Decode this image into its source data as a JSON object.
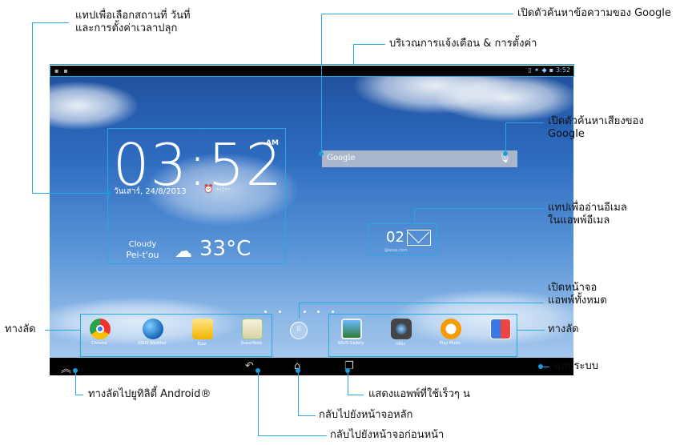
{
  "status_bar": {
    "time": "3:52"
  },
  "clock_widget": {
    "time": "03:52",
    "ampm": "AM",
    "date": "วันเสาร์, 24/8/2013",
    "alarm": "--:--"
  },
  "weather": {
    "condition": "Cloudy",
    "location": "Pei-t'ou",
    "temperature": "33°C",
    "icon": "cloudy-icon"
  },
  "search": {
    "placeholder": "Google"
  },
  "email_widget": {
    "count": "02",
    "account": "@asus.com"
  },
  "left_shortcuts": [
    {
      "label": "Chrome",
      "icon": "chrome-icon"
    },
    {
      "label": "ASUS Weather",
      "icon": "globe-icon"
    },
    {
      "label": "อีเมล",
      "icon": "email-app-icon"
    },
    {
      "label": "SuperNote",
      "icon": "notes-icon"
    }
  ],
  "right_shortcuts": [
    {
      "label": "ASUS Gallery",
      "icon": "gallery-icon"
    },
    {
      "label": "กล้อง",
      "icon": "camera-icon"
    },
    {
      "label": "Play Music",
      "icon": "headphones-icon"
    },
    {
      "label": "",
      "icon": "folder-apps-icon"
    }
  ],
  "annotations": {
    "weather_widget": "แทปเพื่อเลือกสถานที่ วันที่\nและการตั้งค่าเวลาปลุก",
    "google_search": "เปิดตัวค้นหาข้อความของ Google",
    "notifications": "บริเวณการแจ้งเตือน & การตั้งค่า",
    "voice_search": "เปิดตัวค้นหาเสียงของ\nGoogle",
    "email": "แทปเพื่ออ่านอีเมล\nในแอพพ์อีเมล",
    "all_apps": "เปิดหน้าจอ\nแอพพ์ทั้งหมด",
    "shortcuts_left": "ทางลัด",
    "shortcuts_right": "ทางลัด",
    "system_bar": "แถบระบบ",
    "android_utilities": "ทางลัดไปยูทิลิตี้ Android®",
    "recent_apps": "แสดงแอพพ์ที่ใช้เร็วๆ น",
    "home": "กลับไปยังหน้าจอหลัก",
    "back": "กลับไปยังหน้าจอก่อนหน้า"
  }
}
